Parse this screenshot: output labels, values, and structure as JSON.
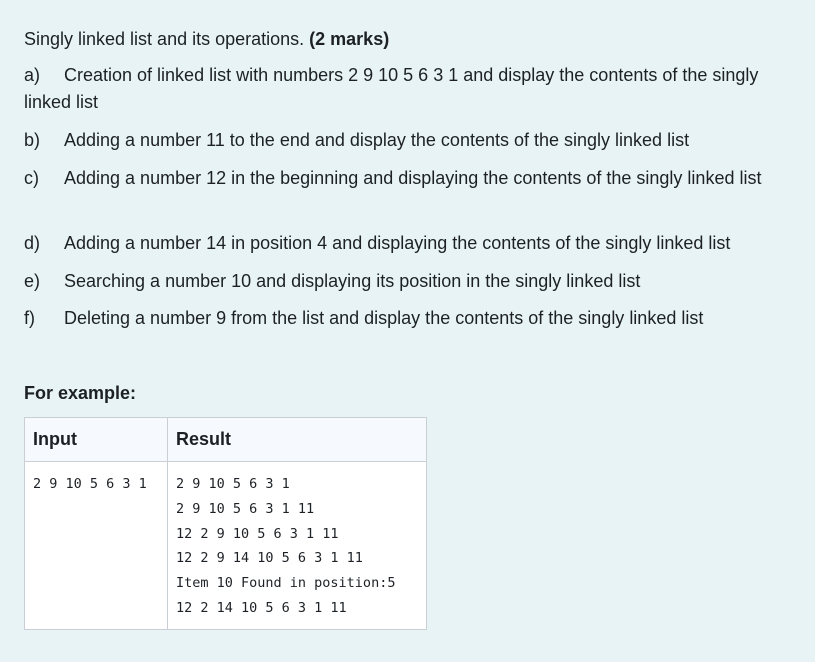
{
  "question": {
    "title_text": "Singly linked list and its operations. ",
    "title_marks": "(2 marks)",
    "items": [
      {
        "letter": "a)",
        "text": "Creation of linked list with numbers 2 9 10 5 6 3 1 and display the contents of the singly linked list"
      },
      {
        "letter": "b)",
        "text": "Adding a number 11 to the end and display the contents of the singly linked list"
      },
      {
        "letter": "c)",
        "text": "Adding a number 12 in the beginning and displaying the contents of the singly linked list"
      },
      {
        "letter": "d)",
        "text": "Adding a number 14 in position 4 and displaying the contents of the singly linked list"
      },
      {
        "letter": "e)",
        "text": "Searching a number 10 and displaying its position in the singly linked list"
      },
      {
        "letter": "f)",
        "text": "Deleting a number 9 from the list and display the contents of the singly linked list"
      }
    ]
  },
  "example": {
    "label": "For example:",
    "headers": {
      "input": "Input",
      "result": "Result"
    },
    "input": "2 9 10 5 6 3 1",
    "result_lines": [
      "2 9 10 5 6 3 1",
      "2 9 10 5 6 3 1 11",
      "12 2 9 10 5 6 3 1 11",
      "12 2 9 14 10 5 6 3 1 11",
      "Item 10 Found in position:5",
      "12 2 14 10 5 6 3 1 11"
    ]
  }
}
